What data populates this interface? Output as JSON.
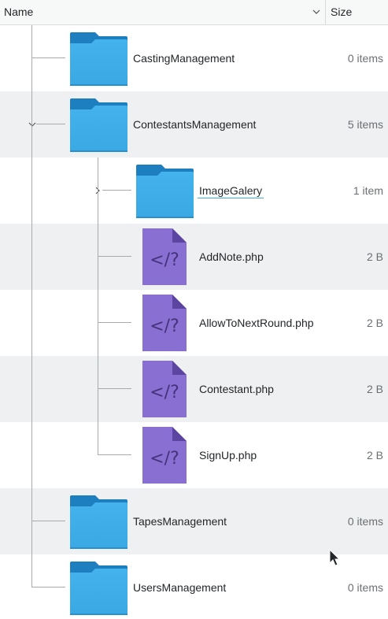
{
  "header": {
    "name_label": "Name",
    "size_label": "Size",
    "sort_indicator": "chevron-down-icon"
  },
  "items": [
    {
      "name": "CastingManagement",
      "size": "0 items",
      "icon": "folder-icon",
      "depth": 0,
      "state": "collapsed"
    },
    {
      "name": "ContestantsManagement",
      "size": "5 items",
      "icon": "folder-icon",
      "depth": 0,
      "state": "expanded"
    },
    {
      "name": "ImageGalery",
      "size": "1 item",
      "icon": "folder-icon",
      "depth": 1,
      "state": "collapsed",
      "hovered": true
    },
    {
      "name": "AddNote.php",
      "size": "2 B",
      "icon": "php-file-icon",
      "depth": 1
    },
    {
      "name": "AllowToNextRound.php",
      "size": "2 B",
      "icon": "php-file-icon",
      "depth": 1
    },
    {
      "name": "Contestant.php",
      "size": "2 B",
      "icon": "php-file-icon",
      "depth": 1
    },
    {
      "name": "SignUp.php",
      "size": "2 B",
      "icon": "php-file-icon",
      "depth": 1
    },
    {
      "name": "TapesManagement",
      "size": "0 items",
      "icon": "folder-icon",
      "depth": 0,
      "state": "collapsed"
    },
    {
      "name": "UsersManagement",
      "size": "0 items",
      "icon": "folder-icon",
      "depth": 0,
      "state": "collapsed"
    }
  ],
  "colors": {
    "folder_front": "#3daee9",
    "folder_back": "#1d80c1",
    "php_file": "#8b6ed2",
    "php_fold": "#5d46a1",
    "row_alt": "#eff0f1",
    "hover_underline": "#3daee9"
  }
}
